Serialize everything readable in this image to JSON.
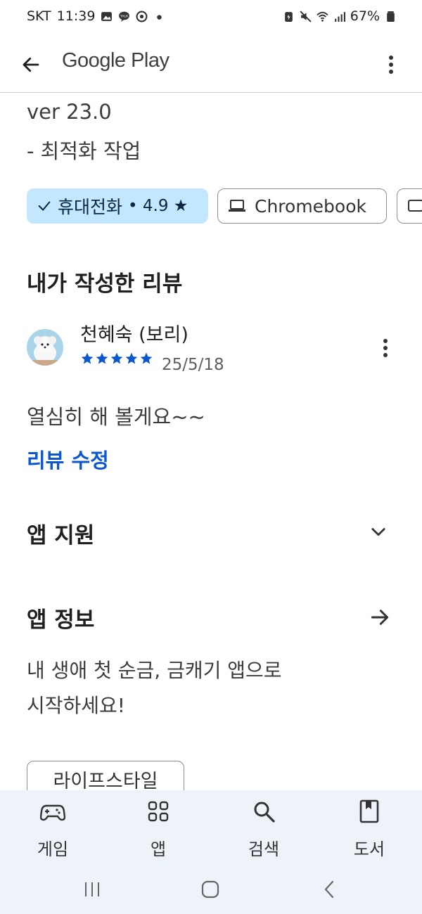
{
  "status_bar": {
    "carrier": "SKT",
    "time": "11:39",
    "battery": "67%"
  },
  "app_bar": {
    "title": "Google Play"
  },
  "whats_new": {
    "version": "ver 23.0",
    "note": "- 최적화 작업"
  },
  "device_chips": [
    {
      "label": "휴대전화",
      "rating": "• 4.9 ★",
      "selected": true
    },
    {
      "label": "Chromebook",
      "selected": false
    },
    {
      "label": "",
      "selected": false
    }
  ],
  "my_review": {
    "heading": "내가 작성한 리뷰",
    "reviewer": "천혜숙 (보리)",
    "stars": 5,
    "date": "25/5/18",
    "text": "열심히 해 볼게요~~",
    "edit_label": "리뷰 수정"
  },
  "app_support": {
    "heading": "앱 지원"
  },
  "app_info": {
    "heading": "앱 정보",
    "desc_line1": "내 생애 첫 순금, 금캐기 앱으로",
    "desc_line2": "시작하세요!",
    "tag": "라이프스타일"
  },
  "bottom_nav": [
    {
      "label": "게임",
      "icon": "gamepad-icon"
    },
    {
      "label": "앱",
      "icon": "apps-grid-icon"
    },
    {
      "label": "검색",
      "icon": "search-icon"
    },
    {
      "label": "도서",
      "icon": "book-icon"
    }
  ],
  "colors": {
    "accent": "#0b57d0",
    "chip_selected": "#c2e7ff",
    "nav_bg": "#eef2f9"
  }
}
